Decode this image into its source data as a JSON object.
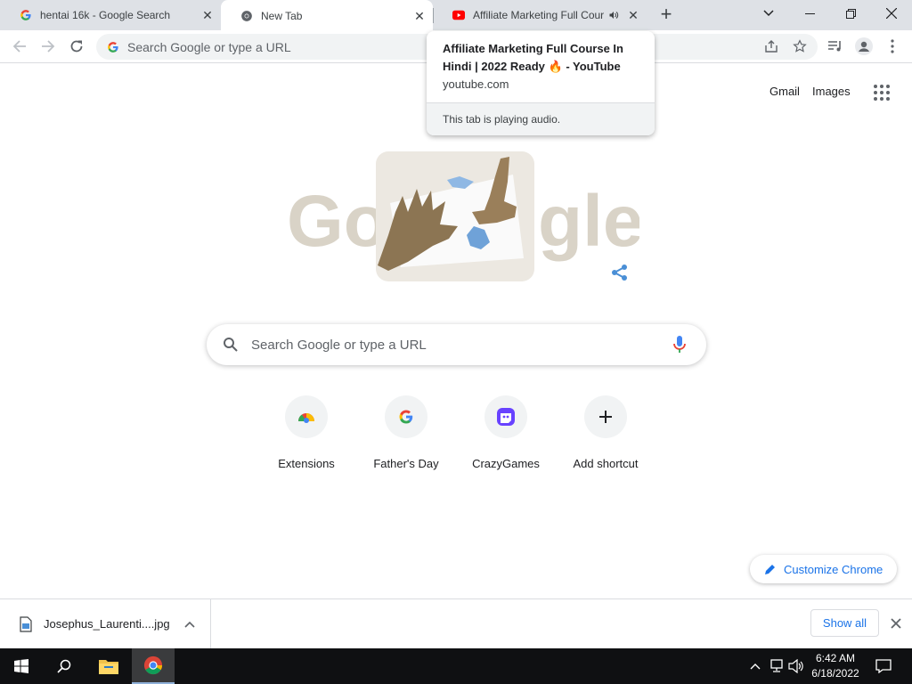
{
  "browser": {
    "tabs": [
      {
        "title": "hentai 16k - Google Search",
        "favicon": "google-g-icon",
        "active": false
      },
      {
        "title": "New Tab",
        "favicon": "chrome-icon",
        "active": true
      },
      {
        "title": "Affiliate Marketing Full Course In Hindi",
        "favicon": "youtube-icon",
        "active": false,
        "audio": true
      }
    ],
    "omnibox_placeholder": "Search Google or type a URL"
  },
  "hovercard": {
    "title": "Affiliate Marketing Full Course In Hindi | 2022 Ready 🔥 - YouTube",
    "domain": "youtube.com",
    "footer": "This tab is playing audio."
  },
  "ntp": {
    "links": {
      "gmail": "Gmail",
      "images": "Images"
    },
    "search_placeholder": "Search Google or type a URL",
    "doodle_letters": "Google",
    "shortcuts": [
      {
        "label": "Extensions",
        "icon": "chrome-webstore-icon"
      },
      {
        "label": "Father's Day",
        "icon": "google-g-icon"
      },
      {
        "label": "CrazyGames",
        "icon": "crazygames-icon"
      },
      {
        "label": "Add shortcut",
        "icon": "plus-icon"
      }
    ],
    "customize_label": "Customize Chrome"
  },
  "downloads": {
    "filename": "Josephus_Laurenti....jpg",
    "show_all": "Show all"
  },
  "taskbar": {
    "time": "6:42 AM",
    "date": "6/18/2022"
  },
  "colors": {
    "accent": "#1a73e8",
    "tabstrip": "#dee1e6",
    "taskbar": "#0f1012"
  }
}
